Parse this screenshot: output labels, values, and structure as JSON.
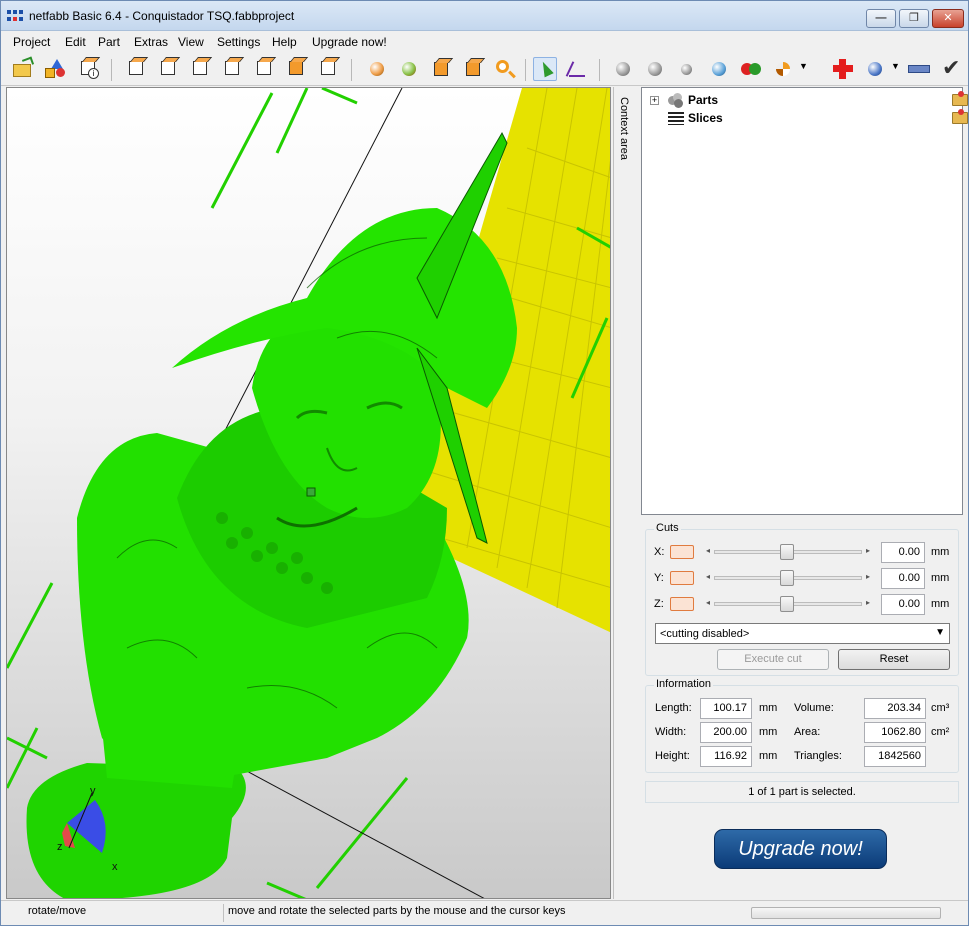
{
  "window": {
    "title": "netfabb Basic 6.4 - Conquistador TSQ.fabbproject"
  },
  "menu": [
    "Project",
    "Edit",
    "Part",
    "Extras",
    "View",
    "Settings",
    "Help",
    "Upgrade now!"
  ],
  "context": {
    "tab_label": "Context area",
    "tree": [
      {
        "label": "Parts",
        "icon": "parts-icon"
      },
      {
        "label": "Slices",
        "icon": "slices-icon"
      }
    ]
  },
  "cuts": {
    "title": "Cuts",
    "rows": [
      {
        "axis": "X:",
        "value": "0.00",
        "unit": "mm"
      },
      {
        "axis": "Y:",
        "value": "0.00",
        "unit": "mm"
      },
      {
        "axis": "Z:",
        "value": "0.00",
        "unit": "mm"
      }
    ],
    "mode": "<cutting disabled>",
    "execute_label": "Execute cut",
    "reset_label": "Reset"
  },
  "information": {
    "title": "Information",
    "length_label": "Length:",
    "length": "100.17",
    "length_unit": "mm",
    "width_label": "Width:",
    "width": "200.00",
    "width_unit": "mm",
    "height_label": "Height:",
    "height": "116.92",
    "height_unit": "mm",
    "volume_label": "Volume:",
    "volume": "203.34",
    "volume_unit": "cm³",
    "area_label": "Area:",
    "area": "1062.80",
    "area_unit": "cm²",
    "triangles_label": "Triangles:",
    "triangles": "1842560"
  },
  "selection_status": "1 of 1 part is selected.",
  "upgrade_button": "Upgrade now!",
  "statusbar": {
    "mode": "rotate/move",
    "hint": "move and rotate the selected parts by the mouse and the cursor keys"
  },
  "viewport": {
    "axis_y": "y",
    "axis_z": "z",
    "axis_x": "x"
  },
  "colors": {
    "model": "#22e000",
    "plate": "#e6e200",
    "accent": "#0b3b78"
  }
}
